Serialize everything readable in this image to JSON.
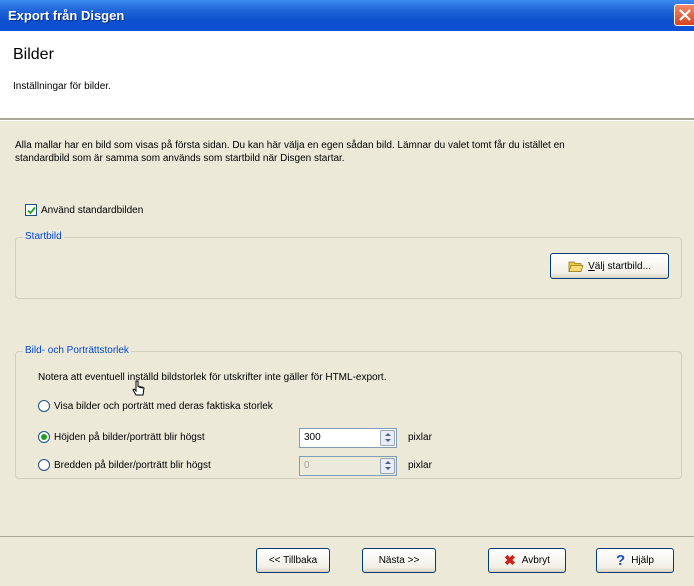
{
  "window": {
    "title": "Export från Disgen"
  },
  "header": {
    "title": "Bilder",
    "subtitle": "Inställningar för bilder."
  },
  "intro": "Alla mallar har en bild som visas på första sidan. Du kan här välja en egen sådan bild. Lämnar du valet tomt får du istället en standardbild som är samma som används som startbild när Disgen startar.",
  "use_default": {
    "label": "Använd standardbilden",
    "checked": true
  },
  "startbild": {
    "legend": "Startbild",
    "choose_button": "Välj startbild..."
  },
  "size": {
    "legend": "Bild- och Porträttstorlek",
    "note": "Notera att eventuell inställd bildstorlek för utskrifter inte gäller för HTML-export.",
    "options": [
      {
        "label": "Visa bilder och porträtt med deras faktiska storlek",
        "selected": false
      },
      {
        "label": "Höjden på bilder/porträtt blir högst",
        "selected": true,
        "value": "300",
        "unit": "pixlar"
      },
      {
        "label": "Bredden på bilder/porträtt blir högst",
        "selected": false,
        "value": "0",
        "unit": "pixlar"
      }
    ]
  },
  "footer": {
    "back": "<< Tillbaka",
    "next": "Nästa >>",
    "cancel": "Avbryt",
    "help": "Hjälp"
  },
  "colors": {
    "titlebar": "#0b4fcf",
    "dialog_bg": "#ece9d8",
    "legend": "#0046d5"
  }
}
